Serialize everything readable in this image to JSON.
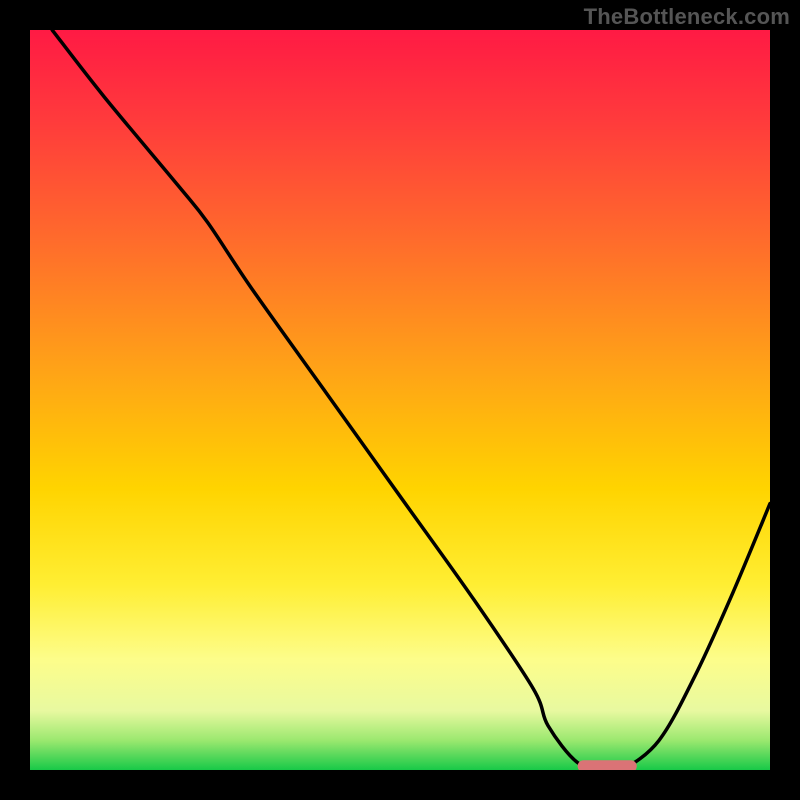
{
  "watermark": "TheBottleneck.com",
  "colors": {
    "background": "#000000",
    "curve": "#000000",
    "marker_fill": "#da7376",
    "gradient_stops": [
      {
        "offset": 0.0,
        "color": "#ff1a44"
      },
      {
        "offset": 0.12,
        "color": "#ff3a3c"
      },
      {
        "offset": 0.28,
        "color": "#ff6a2c"
      },
      {
        "offset": 0.45,
        "color": "#ffa018"
      },
      {
        "offset": 0.62,
        "color": "#ffd400"
      },
      {
        "offset": 0.75,
        "color": "#ffee33"
      },
      {
        "offset": 0.85,
        "color": "#fdfd8a"
      },
      {
        "offset": 0.92,
        "color": "#e8f9a0"
      },
      {
        "offset": 0.96,
        "color": "#9be86f"
      },
      {
        "offset": 1.0,
        "color": "#18c948"
      }
    ]
  },
  "chart_data": {
    "type": "line",
    "title": "",
    "xlabel": "",
    "ylabel": "",
    "xlim": [
      0,
      100
    ],
    "ylim": [
      0,
      100
    ],
    "grid": false,
    "legend": false,
    "series": [
      {
        "name": "bottleneck-curve",
        "x": [
          3,
          10,
          20,
          24,
          30,
          40,
          50,
          60,
          68,
          70,
          74,
          78,
          80,
          85,
          90,
          95,
          100
        ],
        "y": [
          100,
          91,
          79,
          74,
          65,
          51,
          37,
          23,
          11,
          6,
          1,
          0,
          0,
          4,
          13,
          24,
          36
        ]
      }
    ],
    "annotations": [
      {
        "name": "optimal-range-marker",
        "shape": "pill",
        "x_start": 74,
        "x_end": 82,
        "y": 0.5,
        "color": "#da7376"
      }
    ]
  }
}
